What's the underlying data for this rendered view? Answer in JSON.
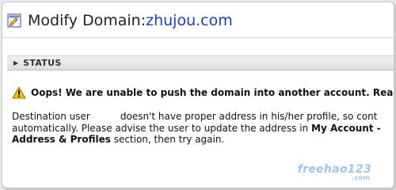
{
  "header": {
    "title_prefix": "Modify Domain: ",
    "domain": "zhujou.com",
    "icon": "edit-page-icon"
  },
  "status": {
    "label": "STATUS",
    "icon": "expand-arrow-icon"
  },
  "warning": {
    "icon": "warning-triangle-icon",
    "text": "Oops! We are unable to push the domain into another account. Reason"
  },
  "message": {
    "part1": "Destination user",
    "part2": "doesn't have proper address in his/her profile, so cont",
    "part3": "automatically. Please advise the user to update the address in ",
    "bold1": "My Account -",
    "bold2": "Address & Profiles",
    "part4": " section, then try again."
  },
  "watermark": {
    "main": "freehao123",
    "sub": ".com"
  },
  "colors": {
    "accent": "#1f3f9a",
    "warning": "#f5c400",
    "watermark": "#9fc4e4"
  }
}
